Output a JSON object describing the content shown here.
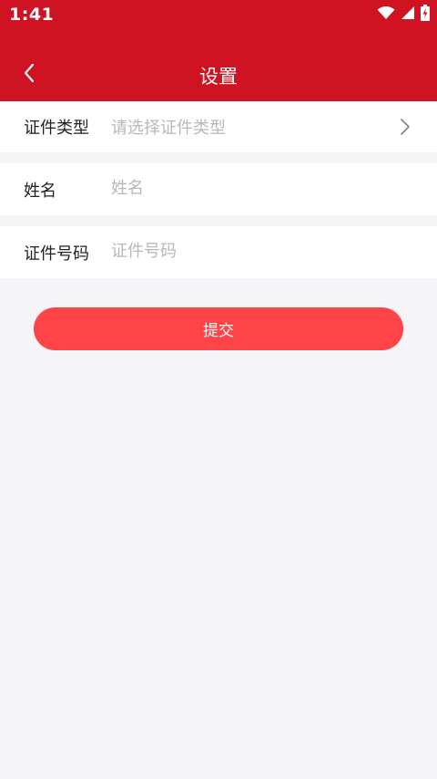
{
  "status_bar": {
    "time": "1:41",
    "icons": [
      "wifi-icon",
      "signal-icon",
      "battery-charging-icon"
    ]
  },
  "nav": {
    "title": "设置",
    "back_icon": "chevron-left-icon"
  },
  "form": {
    "id_type": {
      "label": "证件类型",
      "placeholder": "请选择证件类型",
      "icon": "chevron-right-icon"
    },
    "name": {
      "label": "姓名",
      "placeholder": "姓名"
    },
    "id_number": {
      "label": "证件号码",
      "placeholder": "证件号码"
    }
  },
  "submit": {
    "label": "提交"
  },
  "colors": {
    "header": "#cf1322",
    "button": "#ff4448",
    "background": "#f5f5f7",
    "placeholder": "#b8b8bc"
  }
}
